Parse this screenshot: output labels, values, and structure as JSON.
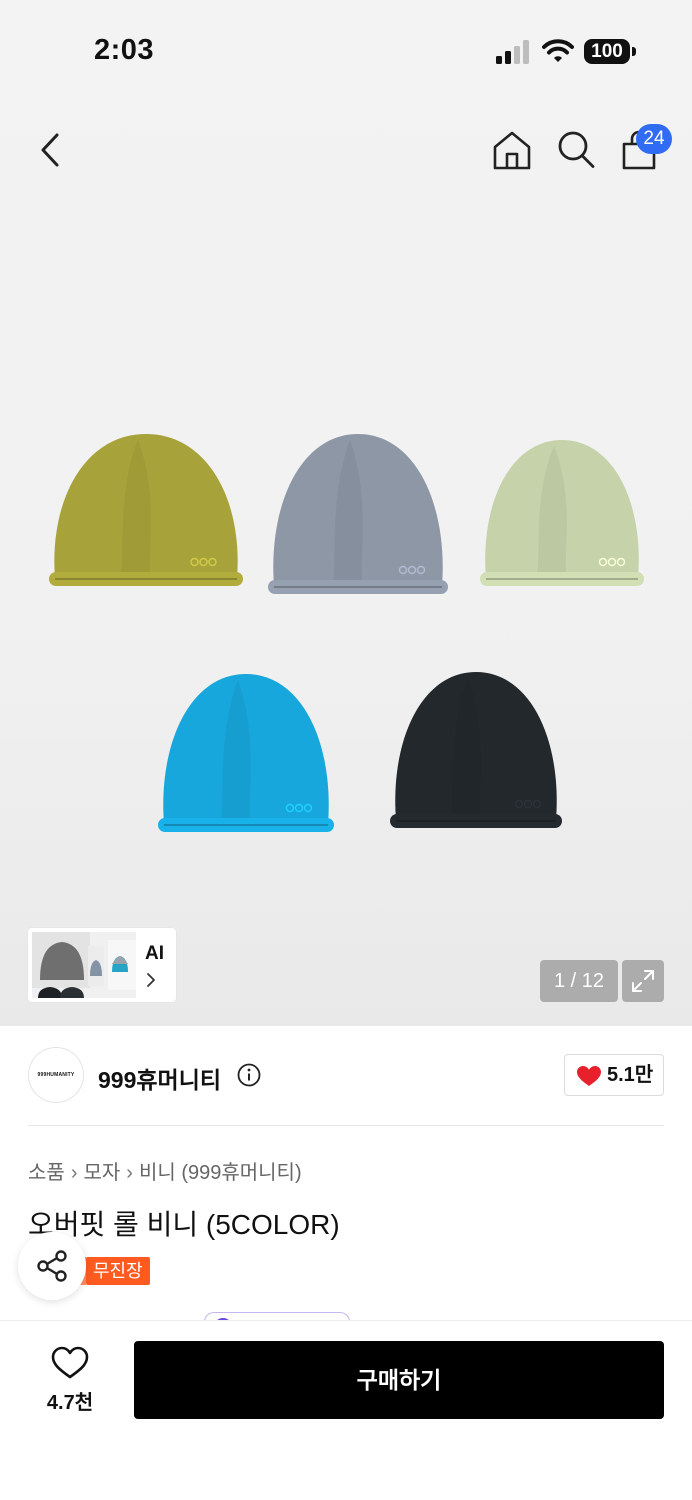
{
  "status_bar": {
    "time": "2:03",
    "battery": "100"
  },
  "header": {
    "cart_count": "24"
  },
  "gallery": {
    "ai_label": "AI",
    "page_counter": "1 / 12",
    "hat_colors": [
      "#a8a23a",
      "#8d97a6",
      "#c6d2aa",
      "#18a7dc",
      "#23282c"
    ]
  },
  "brand": {
    "logo_text": "999HUMANITY",
    "name": "999휴머니티",
    "likes": "5.1만"
  },
  "product": {
    "breadcrumb": [
      "소품",
      "모자",
      "비니 (999휴머니티)"
    ],
    "title": "오버핏 롤 비니 (5COLOR)",
    "tag": "무진장"
  },
  "bottom_bar": {
    "wish_count": "4.7천",
    "buy_label": "구매하기"
  },
  "colors": {
    "accent_blue": "#2f6bf3",
    "tag_orange": "#ff5a1f",
    "heart_red": "#e8202b"
  }
}
